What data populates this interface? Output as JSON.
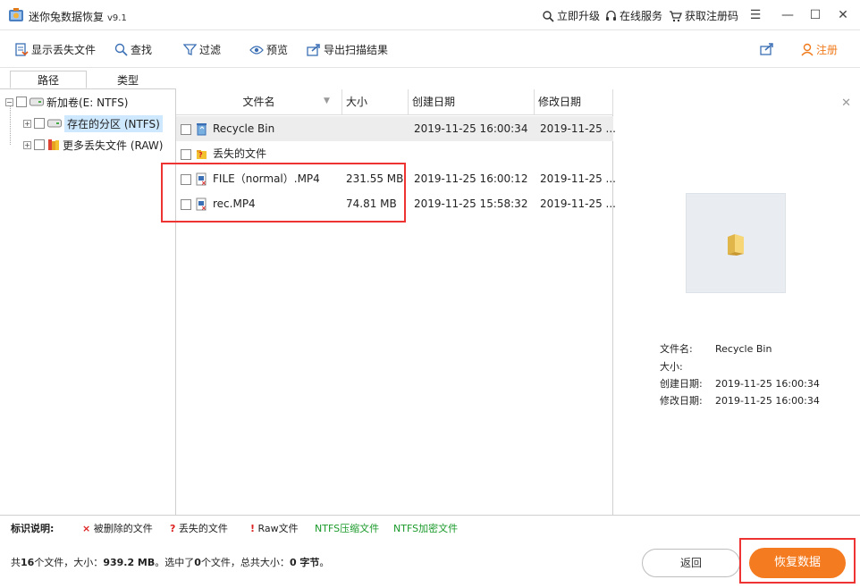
{
  "titlebar": {
    "title": "迷你兔数据恢复",
    "version": "v9.1",
    "upgrade": "立即升级",
    "online_service": "在线服务",
    "get_code": "获取注册码"
  },
  "toolbar": {
    "show_lost": "显示丢失文件",
    "find": "查找",
    "filter": "过滤",
    "preview": "预览",
    "export": "导出扫描结果",
    "register": "注册"
  },
  "tabs": {
    "path": "路径",
    "type": "类型"
  },
  "tree": {
    "volume": "新加卷(E: NTFS)",
    "existing": "存在的分区 (NTFS)",
    "more_lost": "更多丢失文件 (RAW)"
  },
  "list": {
    "headers": {
      "name": "文件名",
      "size": "大小",
      "created": "创建日期",
      "modified": "修改日期"
    },
    "rows": [
      {
        "name": "Recycle Bin",
        "size": "",
        "created": "2019-11-25 16:00:34",
        "modified": "2019-11-25 ..."
      },
      {
        "name": "丢失的文件",
        "size": "",
        "created": "",
        "modified": ""
      },
      {
        "name": "FILE（normal）.MP4",
        "size": "231.55 MB",
        "created": "2019-11-25 16:00:12",
        "modified": "2019-11-25 ..."
      },
      {
        "name": "rec.MP4",
        "size": "74.81 MB",
        "created": "2019-11-25 15:58:32",
        "modified": "2019-11-25 ..."
      }
    ]
  },
  "preview": {
    "name_label": "文件名:",
    "name_value": "Recycle Bin",
    "size_label": "大小:",
    "created_label": "创建日期:",
    "created_value": "2019-11-25 16:00:34",
    "modified_label": "修改日期:",
    "modified_value": "2019-11-25 16:00:34"
  },
  "legend": {
    "title": "标识说明:",
    "deleted_mark": "×",
    "deleted": "被删除的文件",
    "lost_mark": "?",
    "lost": "丢失的文件",
    "raw_mark": "!",
    "raw": "Raw文件",
    "ntfs_compressed": "NTFS压缩文件",
    "ntfs_encrypted": "NTFS加密文件"
  },
  "status": {
    "prefix": "共",
    "file_count": "16",
    "mid1": "个文件，大小：",
    "total_size": "939.2 MB",
    "mid2": "。选中了",
    "selected_count": "0",
    "mid3": "个文件，总共大小：",
    "selected_size": "0 字节",
    "suffix": "。"
  },
  "buttons": {
    "back": "返回",
    "recover": "恢复数据"
  },
  "colors": {
    "accent": "#f47b20",
    "highlight_box": "#e33333",
    "ntfs_green": "#1a9a2a"
  }
}
